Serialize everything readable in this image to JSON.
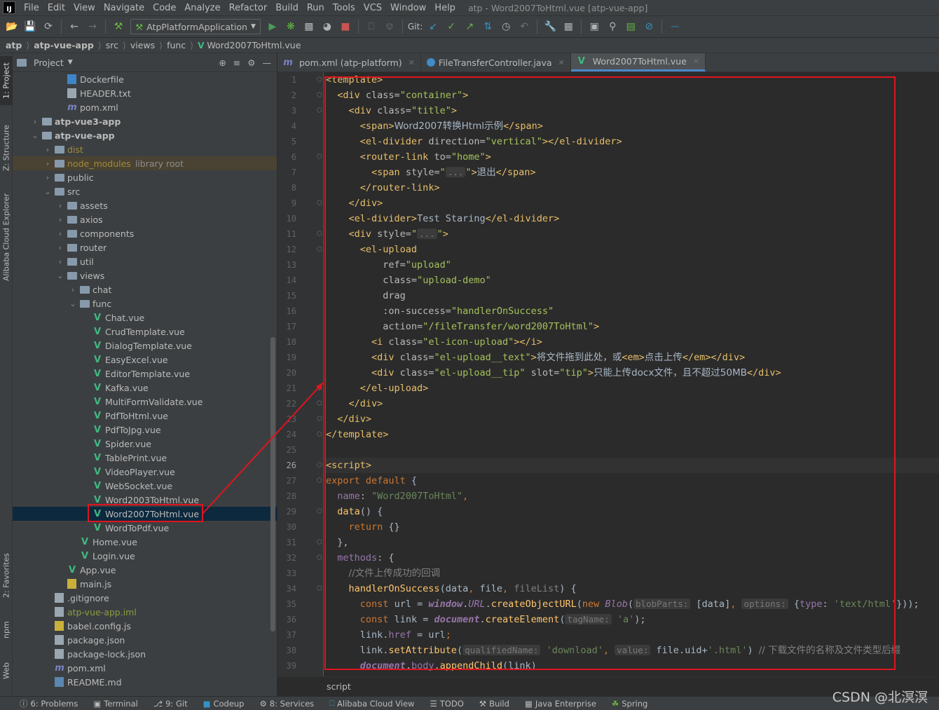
{
  "window": {
    "title": "atp - Word2007ToHtml.vue [atp-vue-app]",
    "menu": [
      "File",
      "Edit",
      "View",
      "Navigate",
      "Code",
      "Analyze",
      "Refactor",
      "Build",
      "Run",
      "Tools",
      "VCS",
      "Window",
      "Help"
    ]
  },
  "toolbar": {
    "run_config": "AtpPlatformApplication",
    "git_label": "Git:"
  },
  "breadcrumb": [
    "atp",
    "atp-vue-app",
    "src",
    "views",
    "func",
    "Word2007ToHtml.vue"
  ],
  "left_strip": {
    "project": "1: Project",
    "structure": "Z: Structure",
    "alibaba": "Alibaba Cloud Explorer",
    "favorites": "2: Favorites",
    "npm": "npm",
    "web": "Web"
  },
  "project_panel": {
    "title": "Project",
    "tree": [
      {
        "label": "Dockerfile",
        "icon": "docker-file-icon",
        "depth": 3
      },
      {
        "label": "HEADER.txt",
        "icon": "text-file-icon",
        "depth": 3
      },
      {
        "label": "pom.xml",
        "icon": "maven-icon",
        "depth": 3
      },
      {
        "label": "atp-vue3-app",
        "icon": "module-folder-icon",
        "depth": 1,
        "chevron": ">",
        "bold": true
      },
      {
        "label": "atp-vue-app",
        "icon": "module-folder-icon",
        "depth": 1,
        "chevron": "v",
        "bold": true
      },
      {
        "label": "dist",
        "icon": "folder-icon",
        "depth": 2,
        "chevron": ">",
        "style": "orange"
      },
      {
        "label": "node_modules",
        "suffix": "library root",
        "icon": "folder-icon",
        "depth": 2,
        "chevron": ">",
        "style": "orange",
        "lib": true
      },
      {
        "label": "public",
        "icon": "folder-icon",
        "depth": 2,
        "chevron": ">"
      },
      {
        "label": "src",
        "icon": "folder-icon",
        "depth": 2,
        "chevron": "v"
      },
      {
        "label": "assets",
        "icon": "folder-icon",
        "depth": 3,
        "chevron": ">"
      },
      {
        "label": "axios",
        "icon": "folder-icon",
        "depth": 3,
        "chevron": ">"
      },
      {
        "label": "components",
        "icon": "folder-icon",
        "depth": 3,
        "chevron": ">"
      },
      {
        "label": "router",
        "icon": "folder-icon",
        "depth": 3,
        "chevron": ">"
      },
      {
        "label": "util",
        "icon": "folder-icon",
        "depth": 3,
        "chevron": ">"
      },
      {
        "label": "views",
        "icon": "folder-icon",
        "depth": 3,
        "chevron": "v"
      },
      {
        "label": "chat",
        "icon": "folder-icon",
        "depth": 4,
        "chevron": ">"
      },
      {
        "label": "func",
        "icon": "folder-icon",
        "depth": 4,
        "chevron": "v"
      },
      {
        "label": "Chat.vue",
        "icon": "vue-icon",
        "depth": 5
      },
      {
        "label": "CrudTemplate.vue",
        "icon": "vue-icon",
        "depth": 5
      },
      {
        "label": "DialogTemplate.vue",
        "icon": "vue-icon",
        "depth": 5
      },
      {
        "label": "EasyExcel.vue",
        "icon": "vue-icon",
        "depth": 5
      },
      {
        "label": "EditorTemplate.vue",
        "icon": "vue-icon",
        "depth": 5
      },
      {
        "label": "Kafka.vue",
        "icon": "vue-icon",
        "depth": 5
      },
      {
        "label": "MultiFormValidate.vue",
        "icon": "vue-icon",
        "depth": 5
      },
      {
        "label": "PdfToHtml.vue",
        "icon": "vue-icon",
        "depth": 5
      },
      {
        "label": "PdfToJpg.vue",
        "icon": "vue-icon",
        "depth": 5
      },
      {
        "label": "Spider.vue",
        "icon": "vue-icon",
        "depth": 5
      },
      {
        "label": "TablePrint.vue",
        "icon": "vue-icon",
        "depth": 5
      },
      {
        "label": "VideoPlayer.vue",
        "icon": "vue-icon",
        "depth": 5
      },
      {
        "label": "WebSocket.vue",
        "icon": "vue-icon",
        "depth": 5
      },
      {
        "label": "Word2003ToHtml.vue",
        "icon": "vue-icon",
        "depth": 5
      },
      {
        "label": "Word2007ToHtml.vue",
        "icon": "vue-icon",
        "depth": 5,
        "selected": true
      },
      {
        "label": "WordToPdf.vue",
        "icon": "vue-icon",
        "depth": 5
      },
      {
        "label": "Home.vue",
        "icon": "vue-icon",
        "depth": 4
      },
      {
        "label": "Login.vue",
        "icon": "vue-icon",
        "depth": 4
      },
      {
        "label": "App.vue",
        "icon": "vue-icon",
        "depth": 3
      },
      {
        "label": "main.js",
        "icon": "js-file-icon",
        "depth": 3
      },
      {
        "label": ".gitignore",
        "icon": "text-file-icon",
        "depth": 2
      },
      {
        "label": "atp-vue-app.iml",
        "icon": "iml-file-icon",
        "depth": 2,
        "style": "green"
      },
      {
        "label": "babel.config.js",
        "icon": "js-file-icon",
        "depth": 2
      },
      {
        "label": "package.json",
        "icon": "json-file-icon",
        "depth": 2
      },
      {
        "label": "package-lock.json",
        "icon": "json-file-icon",
        "depth": 2
      },
      {
        "label": "pom.xml",
        "icon": "maven-icon",
        "depth": 2
      },
      {
        "label": "README.md",
        "icon": "md-file-icon",
        "depth": 2
      }
    ]
  },
  "editor": {
    "tabs": [
      {
        "label": "pom.xml (atp-platform)",
        "icon": "maven-icon",
        "active": false
      },
      {
        "label": "FileTransferController.java",
        "icon": "java-class-icon",
        "active": false
      },
      {
        "label": "Word2007ToHtml.vue",
        "icon": "vue-icon",
        "active": true
      }
    ],
    "current_line": 26,
    "lines": [
      [
        [
          "tg",
          "<template>"
        ]
      ],
      [
        [
          "p",
          "  "
        ],
        [
          "tg",
          "<div "
        ],
        [
          "at",
          "class="
        ],
        [
          "av",
          "\"container\""
        ],
        [
          "tg",
          ">"
        ]
      ],
      [
        [
          "p",
          "    "
        ],
        [
          "tg",
          "<div "
        ],
        [
          "at",
          "class="
        ],
        [
          "av",
          "\"title\""
        ],
        [
          "tg",
          ">"
        ]
      ],
      [
        [
          "p",
          "      "
        ],
        [
          "tg",
          "<span>"
        ],
        [
          "p",
          "Word2007转换Html示例"
        ],
        [
          "tg",
          "</span>"
        ]
      ],
      [
        [
          "p",
          "      "
        ],
        [
          "tg",
          "<el-divider "
        ],
        [
          "at",
          "direction="
        ],
        [
          "av",
          "\"vertical\""
        ],
        [
          "tg",
          "></el-divider>"
        ]
      ],
      [
        [
          "p",
          "      "
        ],
        [
          "tg",
          "<router-link "
        ],
        [
          "at",
          "to="
        ],
        [
          "av",
          "\"home\""
        ],
        [
          "tg",
          ">"
        ]
      ],
      [
        [
          "p",
          "        "
        ],
        [
          "tg",
          "<span "
        ],
        [
          "at",
          "style="
        ],
        [
          "av",
          "\""
        ],
        [
          "hint",
          "..."
        ],
        [
          "av",
          "\""
        ],
        [
          "tg",
          ">"
        ],
        [
          "p",
          "退出"
        ],
        [
          "tg",
          "</span>"
        ]
      ],
      [
        [
          "p",
          "      "
        ],
        [
          "tg",
          "</router-link>"
        ]
      ],
      [
        [
          "p",
          "    "
        ],
        [
          "tg",
          "</div>"
        ]
      ],
      [
        [
          "p",
          "    "
        ],
        [
          "tg",
          "<el-divider>"
        ],
        [
          "p",
          "Test Staring"
        ],
        [
          "tg",
          "</el-divider>"
        ]
      ],
      [
        [
          "p",
          "    "
        ],
        [
          "tg",
          "<div "
        ],
        [
          "at",
          "style="
        ],
        [
          "av",
          "\""
        ],
        [
          "hint",
          "..."
        ],
        [
          "av",
          "\""
        ],
        [
          "tg",
          ">"
        ]
      ],
      [
        [
          "p",
          "      "
        ],
        [
          "tg",
          "<el-upload"
        ]
      ],
      [
        [
          "p",
          "          "
        ],
        [
          "at",
          "ref="
        ],
        [
          "av",
          "\"upload\""
        ]
      ],
      [
        [
          "p",
          "          "
        ],
        [
          "at",
          "class="
        ],
        [
          "av",
          "\"upload-demo\""
        ]
      ],
      [
        [
          "p",
          "          "
        ],
        [
          "at",
          "drag"
        ]
      ],
      [
        [
          "p",
          "          "
        ],
        [
          "at",
          ":on-success="
        ],
        [
          "av",
          "\"handlerOnSuccess\""
        ]
      ],
      [
        [
          "p",
          "          "
        ],
        [
          "at",
          "action="
        ],
        [
          "av",
          "\"/fileTransfer/word2007ToHtml\""
        ],
        [
          "tg",
          ">"
        ]
      ],
      [
        [
          "p",
          "        "
        ],
        [
          "tg",
          "<i "
        ],
        [
          "at",
          "class="
        ],
        [
          "av",
          "\"el-icon-upload\""
        ],
        [
          "tg",
          "></i>"
        ]
      ],
      [
        [
          "p",
          "        "
        ],
        [
          "tg",
          "<div "
        ],
        [
          "at",
          "class="
        ],
        [
          "av",
          "\"el-upload__text\""
        ],
        [
          "tg",
          ">"
        ],
        [
          "p",
          "将文件拖到此处，或"
        ],
        [
          "tg",
          "<em>"
        ],
        [
          "p",
          "点击上传"
        ],
        [
          "tg",
          "</em></div>"
        ]
      ],
      [
        [
          "p",
          "        "
        ],
        [
          "tg",
          "<div "
        ],
        [
          "at",
          "class="
        ],
        [
          "av",
          "\"el-upload__tip\""
        ],
        [
          "p",
          " "
        ],
        [
          "at",
          "slot="
        ],
        [
          "av",
          "\"tip\""
        ],
        [
          "tg",
          ">"
        ],
        [
          "p",
          "只能上传docx文件，且不超过50MB"
        ],
        [
          "tg",
          "</div>"
        ]
      ],
      [
        [
          "p",
          "      "
        ],
        [
          "tg",
          "</el-upload>"
        ]
      ],
      [
        [
          "p",
          "    "
        ],
        [
          "tg",
          "</div>"
        ]
      ],
      [
        [
          "p",
          "  "
        ],
        [
          "tg",
          "</div>"
        ]
      ],
      [
        [
          "tg",
          "</template>"
        ]
      ],
      [
        [
          "p",
          ""
        ]
      ],
      [
        [
          "tg",
          "<script>"
        ]
      ],
      [
        [
          "kw",
          "export default "
        ],
        [
          "p",
          "{"
        ]
      ],
      [
        [
          "p",
          "  "
        ],
        [
          "pn",
          "name"
        ],
        [
          "p",
          ": "
        ],
        [
          "st",
          "\"Word2007ToHtml\""
        ],
        [
          "kw",
          ","
        ]
      ],
      [
        [
          "p",
          "  "
        ],
        [
          "fn",
          "data"
        ],
        [
          "p",
          "() {"
        ]
      ],
      [
        [
          "p",
          "    "
        ],
        [
          "kw",
          "return "
        ],
        [
          "p",
          "{}"
        ]
      ],
      [
        [
          "p",
          "  },"
        ]
      ],
      [
        [
          "p",
          "  "
        ],
        [
          "pn",
          "methods"
        ],
        [
          "p",
          ": {"
        ]
      ],
      [
        [
          "p",
          "    "
        ],
        [
          "cm",
          "//文件上传成功的回调"
        ]
      ],
      [
        [
          "p",
          "    "
        ],
        [
          "fn",
          "handlerOnSuccess"
        ],
        [
          "p",
          "(data"
        ],
        [
          "kw",
          ", "
        ],
        [
          "p",
          "file"
        ],
        [
          "kw",
          ", "
        ],
        [
          "cm",
          "fileList"
        ],
        [
          "p",
          ") {"
        ]
      ],
      [
        [
          "p",
          "      "
        ],
        [
          "kw",
          "const "
        ],
        [
          "p",
          "url = "
        ],
        [
          "gv",
          "window"
        ],
        [
          "p",
          "."
        ],
        [
          "gl",
          "URL"
        ],
        [
          "p",
          "."
        ],
        [
          "fn",
          "createObjectURL"
        ],
        [
          "p",
          "("
        ],
        [
          "kw",
          "new "
        ],
        [
          "gl",
          "Blob"
        ],
        [
          "p",
          "("
        ],
        [
          "hint",
          "blobParts:"
        ],
        [
          "p",
          " [data]"
        ],
        [
          "kw",
          ", "
        ],
        [
          "hint",
          "options:"
        ],
        [
          "p",
          " {"
        ],
        [
          "pn",
          "type"
        ],
        [
          "p",
          ": "
        ],
        [
          "st",
          "'text/html'"
        ],
        [
          "p",
          "}));"
        ]
      ],
      [
        [
          "p",
          "      "
        ],
        [
          "kw",
          "const "
        ],
        [
          "p",
          "link = "
        ],
        [
          "gv",
          "document"
        ],
        [
          "p",
          "."
        ],
        [
          "fn",
          "createElement"
        ],
        [
          "p",
          "("
        ],
        [
          "hint",
          "tagName:"
        ],
        [
          "p",
          " "
        ],
        [
          "st",
          "'a'"
        ],
        [
          "p",
          ");"
        ]
      ],
      [
        [
          "p",
          "      link."
        ],
        [
          "pn",
          "href"
        ],
        [
          "p",
          " = url"
        ],
        [
          "kw",
          ";"
        ]
      ],
      [
        [
          "p",
          "      link."
        ],
        [
          "fn",
          "setAttribute"
        ],
        [
          "p",
          "("
        ],
        [
          "hint",
          "qualifiedName:"
        ],
        [
          "p",
          " "
        ],
        [
          "st",
          "'download'"
        ],
        [
          "kw",
          ", "
        ],
        [
          "hint",
          "value:"
        ],
        [
          "p",
          " file.uid+"
        ],
        [
          "st",
          "'.html'"
        ],
        [
          "p",
          ") "
        ],
        [
          "cm",
          "// 下载文件的名称及文件类型后缀"
        ]
      ],
      [
        [
          "p",
          "      "
        ],
        [
          "gv",
          "document"
        ],
        [
          "p",
          "."
        ],
        [
          "pn",
          "body"
        ],
        [
          "p",
          "."
        ],
        [
          "fn",
          "appendChild"
        ],
        [
          "p",
          "(link)"
        ]
      ]
    ],
    "crumb": "script"
  },
  "statusbar": [
    {
      "label": "6: Problems",
      "icon": "problems-icon"
    },
    {
      "label": "Terminal",
      "icon": "terminal-icon"
    },
    {
      "label": "9: Git",
      "icon": "git-branch-icon"
    },
    {
      "label": "Codeup",
      "icon": "codeup-icon"
    },
    {
      "label": "8: Services",
      "icon": "services-icon"
    },
    {
      "label": "Alibaba Cloud View",
      "icon": "alibaba-icon"
    },
    {
      "label": "TODO",
      "icon": "todo-icon"
    },
    {
      "label": "Build",
      "icon": "hammer-icon"
    },
    {
      "label": "Java Enterprise",
      "icon": "java-enterprise-icon"
    },
    {
      "label": "Spring",
      "icon": "spring-icon"
    }
  ],
  "watermark": "CSDN @北溟溟",
  "colors": {
    "annotation": "#e0141e",
    "vue": "#41b883",
    "selection": "#0d293e"
  }
}
